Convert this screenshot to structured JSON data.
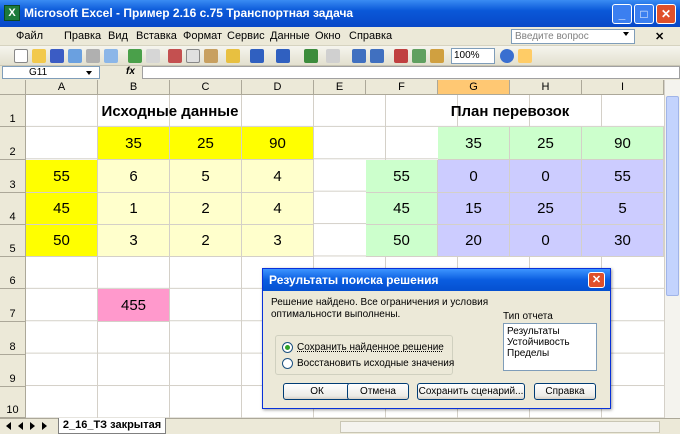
{
  "window": {
    "title": "Microsoft Excel - Пример 2.16 с.75 Транспортная задача",
    "minimize": "_",
    "maximize": "□",
    "close": "✕"
  },
  "menu": {
    "items": [
      "Файл",
      "Правка",
      "Вид",
      "Вставка",
      "Формат",
      "Сервис",
      "Данные",
      "Окно",
      "Справка"
    ],
    "help_placeholder": "Введите вопрос",
    "doc_close": "✕"
  },
  "toolbar": {
    "zoom": "100%"
  },
  "formula_bar": {
    "cell_ref": "G11",
    "fx": "fx",
    "value": ""
  },
  "sheet": {
    "columns": [
      "A",
      "B",
      "C",
      "D",
      "E",
      "F",
      "G",
      "H",
      "I"
    ],
    "selected_column": "G",
    "rows": [
      "1",
      "2",
      "3",
      "4",
      "5",
      "6",
      "7",
      "8",
      "9",
      "10"
    ],
    "source_heading": "Исходные данные",
    "plan_heading": "План перевозок",
    "demand": [
      "35",
      "25",
      "90"
    ],
    "supply": [
      "55",
      "45",
      "50"
    ],
    "costs": [
      [
        "6",
        "5",
        "4"
      ],
      [
        "1",
        "2",
        "4"
      ],
      [
        "3",
        "2",
        "3"
      ]
    ],
    "plan_demand": [
      "35",
      "25",
      "90"
    ],
    "plan_supply": [
      "55",
      "45",
      "50"
    ],
    "plan": [
      [
        "0",
        "0",
        "55"
      ],
      [
        "15",
        "25",
        "5"
      ],
      [
        "20",
        "0",
        "30"
      ]
    ],
    "total": "455",
    "colors": {
      "yellow": "#ffff00",
      "light_yellow": "#ffffcc",
      "light_green": "#ccffcc",
      "lavender": "#ccccff",
      "pink": "#ff99cc"
    }
  },
  "tabs": {
    "active": "2_16_ТЗ закрытая"
  },
  "dialog": {
    "title": "Результаты поиска решения",
    "message": "Решение найдено. Все ограничения и условия оптимальности выполнены.",
    "options": [
      "Сохранить найденное решение",
      "Восстановить исходные значения"
    ],
    "selected_option": 0,
    "report_label": "Тип отчета",
    "reports": [
      "Результаты",
      "Устойчивость",
      "Пределы"
    ],
    "buttons": {
      "ok": "ОК",
      "cancel": "Отмена",
      "save_scenario": "Сохранить сценарий...",
      "help": "Справка"
    }
  }
}
